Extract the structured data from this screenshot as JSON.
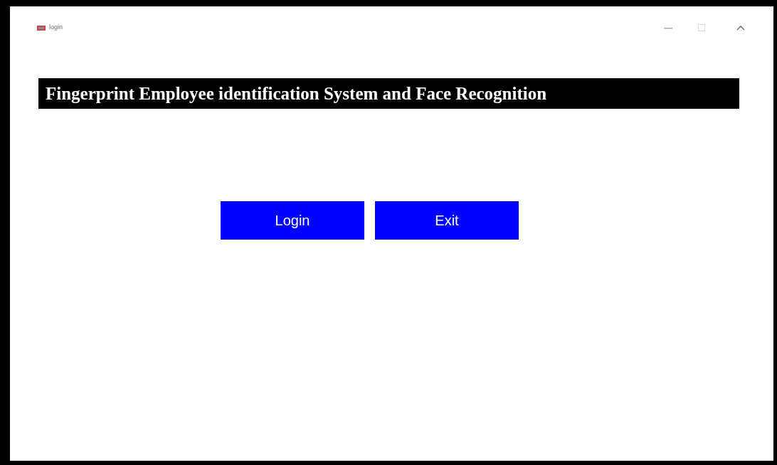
{
  "window": {
    "title": "login"
  },
  "banner": {
    "text": "Fingerprint Employee identification System and Face Recognition"
  },
  "buttons": [
    {
      "label": "Login"
    },
    {
      "label": "Exit"
    }
  ]
}
